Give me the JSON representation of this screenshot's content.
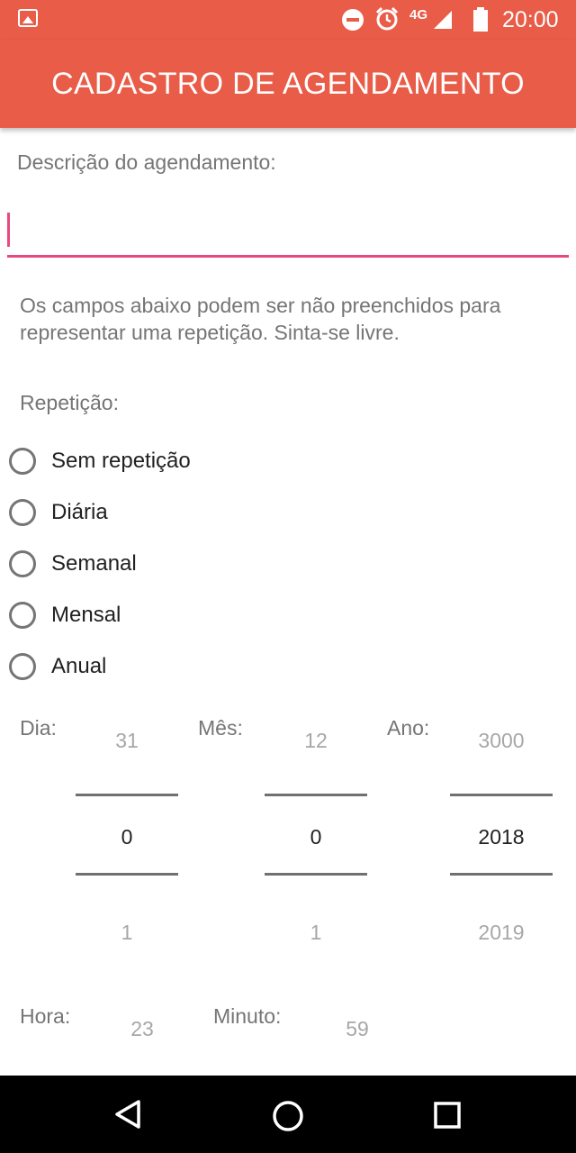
{
  "status_bar": {
    "time": "20:00",
    "network": "4G",
    "icons": [
      "image-notification-icon",
      "do-not-disturb-icon",
      "alarm-icon",
      "signal-icon",
      "battery-icon"
    ]
  },
  "app_bar": {
    "title": "CADASTRO DE AGENDAMENTO",
    "color": "#e85c48"
  },
  "form": {
    "description_label": "Descrição do agendamento:",
    "description_value": "",
    "note": "Os campos abaixo podem ser não preenchidos para representar uma repetição. Sinta-se livre.",
    "repetition_label": "Repetição:",
    "repetition_options": [
      "Sem repetição",
      "Diária",
      "Semanal",
      "Mensal",
      "Anual"
    ],
    "accent_color": "#e84980"
  },
  "date_pickers": {
    "day": {
      "label": "Dia:",
      "prev": "31",
      "value": "0",
      "next": "1"
    },
    "month": {
      "label": "Mês:",
      "prev": "12",
      "value": "0",
      "next": "1"
    },
    "year": {
      "label": "Ano:",
      "prev": "3000",
      "value": "2018",
      "next": "2019"
    }
  },
  "time_pickers": {
    "hour": {
      "label": "Hora:",
      "prev": "23"
    },
    "minute": {
      "label": "Minuto:",
      "prev": "59"
    }
  },
  "nav_bar": {
    "icons": [
      "back-icon",
      "home-icon",
      "recents-icon"
    ]
  }
}
